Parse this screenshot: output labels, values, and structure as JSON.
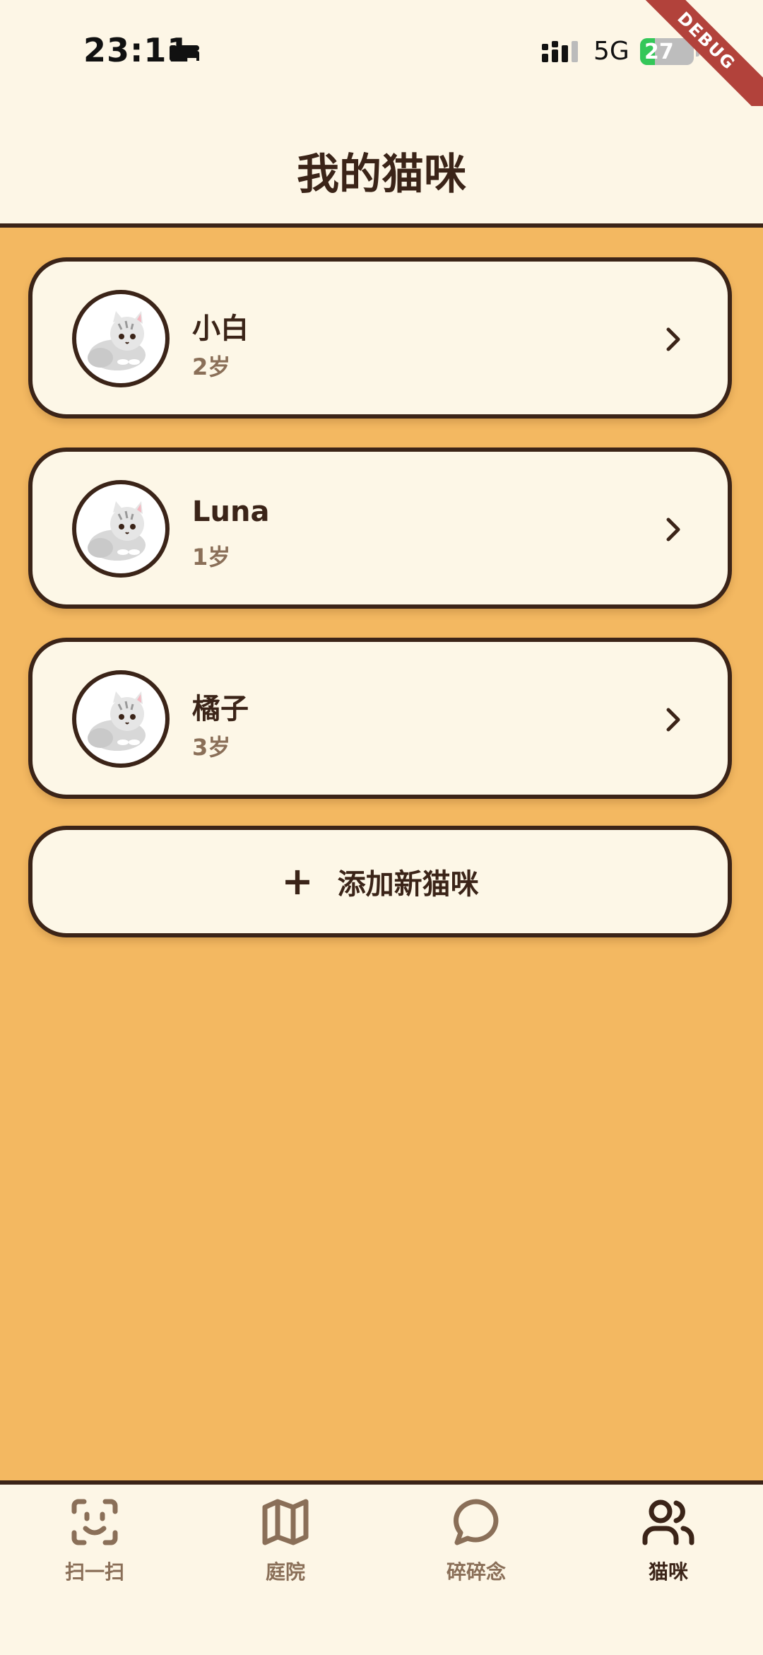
{
  "status_bar": {
    "time": "23:11",
    "network": "5G",
    "battery": "27",
    "battery_level": 0.27,
    "icons": [
      "bed-icon",
      "signal-icon",
      "battery-charging-icon"
    ]
  },
  "debug_banner": "DEBUG",
  "header": {
    "title": "我的猫咪"
  },
  "cats": [
    {
      "name": "小白",
      "age": "2岁"
    },
    {
      "name": "Luna",
      "age": "1岁"
    },
    {
      "name": "橘子",
      "age": "3岁"
    }
  ],
  "add_button": {
    "icon": "+",
    "label": "添加新猫咪"
  },
  "bottom_nav": {
    "items": [
      {
        "label": "扫一扫",
        "icon": "face-scan-icon",
        "active": false
      },
      {
        "label": "庭院",
        "icon": "map-icon",
        "active": false
      },
      {
        "label": "碎碎念",
        "icon": "chat-bubble-icon",
        "active": false
      },
      {
        "label": "猫咪",
        "icon": "users-icon",
        "active": true
      }
    ]
  },
  "colors": {
    "background": "#F3B861",
    "surface": "#FDF6E6",
    "ink": "#3B2418",
    "muted": "#8A6F58",
    "battery_green": "#34C759",
    "debug_red": "#B2423B"
  }
}
